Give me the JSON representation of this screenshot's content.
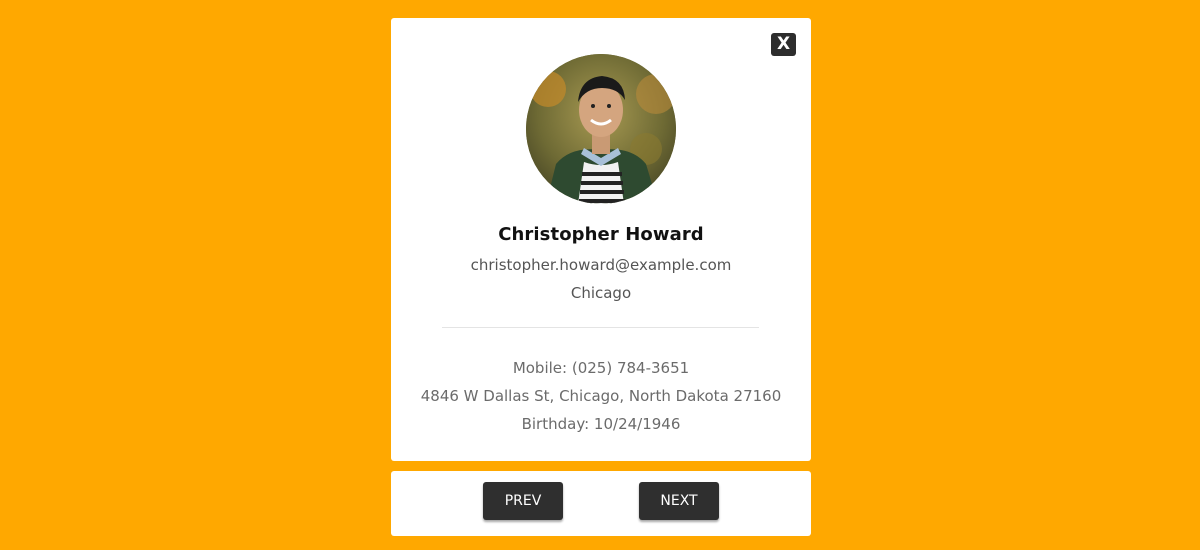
{
  "card": {
    "close_label": "X",
    "name": "Christopher Howard",
    "email": "christopher.howard@example.com",
    "city": "Chicago",
    "mobile": "Mobile: (025) 784-3651",
    "address": "4846 W Dallas St, Chicago, North Dakota 27160",
    "birthday": "Birthday: 10/24/1946"
  },
  "nav": {
    "prev_label": "PREV",
    "next_label": "NEXT"
  },
  "colors": {
    "background": "#ffa800",
    "card": "#ffffff",
    "button": "#2f2f2f"
  }
}
